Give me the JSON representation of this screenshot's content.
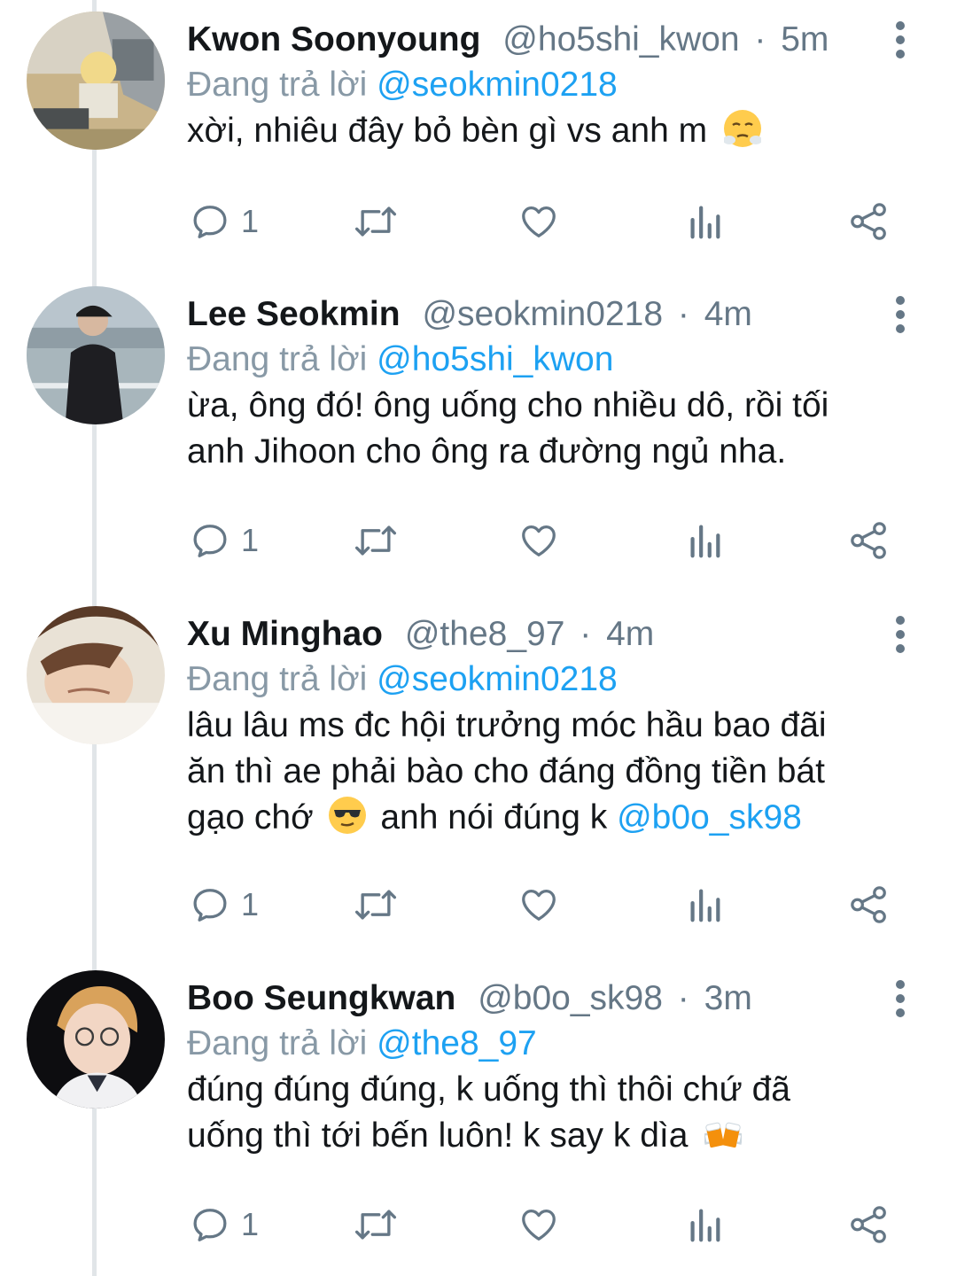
{
  "tweets": [
    {
      "name": "Kwon Soonyoung",
      "handle": "@ho5shi_kwon",
      "separator": "·",
      "time": "5m",
      "replying_label": "Đang trả lời",
      "replying_to": "@seokmin0218",
      "text": "xời, nhiêu đây bỏ bèn gì vs anh m",
      "text_emoji": "steam-from-nose-emoji",
      "reply_count": "1"
    },
    {
      "name": "Lee Seokmin",
      "handle": "@seokmin0218",
      "separator": "·",
      "time": "4m",
      "replying_label": "Đang trả lời",
      "replying_to": "@ho5shi_kwon",
      "text_line1": "ừa, ông đó! ông uống cho nhiều dô, rồi tối",
      "text_line2": "anh Jihoon cho ông ra đường ngủ nha.",
      "reply_count": "1"
    },
    {
      "name": "Xu Minghao",
      "handle": "@the8_97",
      "separator": "·",
      "time": "4m",
      "replying_label": "Đang trả lời",
      "replying_to": "@seokmin0218",
      "text_line1": "lâu lâu ms đc hội trưởng móc hầu bao đãi",
      "text_line2": "ăn thì ae phải bào cho đáng đồng tiền bát",
      "text_line3a": "gạo chớ",
      "text_line3b": "anh nói đúng k",
      "text_mention": "@b0o_sk98",
      "text_emoji": "sunglasses-emoji",
      "reply_count": "1"
    },
    {
      "name": "Boo Seungkwan",
      "handle": "@b0o_sk98",
      "separator": "·",
      "time": "3m",
      "replying_label": "Đang trả lời",
      "replying_to": "@the8_97",
      "text_line1": "đúng đúng đúng, k uống thì thôi chứ đã",
      "text_line2": "uống thì tới bến luôn! k say k dìa",
      "text_emoji": "clinking-beer-mugs-emoji",
      "reply_count": "1"
    }
  ],
  "icons": {
    "reply": "reply-icon",
    "retweet": "retweet-icon",
    "like": "heart-icon",
    "analytics": "analytics-icon",
    "share": "share-icon",
    "more": "more-vertical-icon"
  },
  "colors": {
    "name": "#14171a",
    "secondary": "#657786",
    "replying_label": "#8899a6",
    "mention": "#1da1f2",
    "thread_line": "#e1e5e8"
  }
}
